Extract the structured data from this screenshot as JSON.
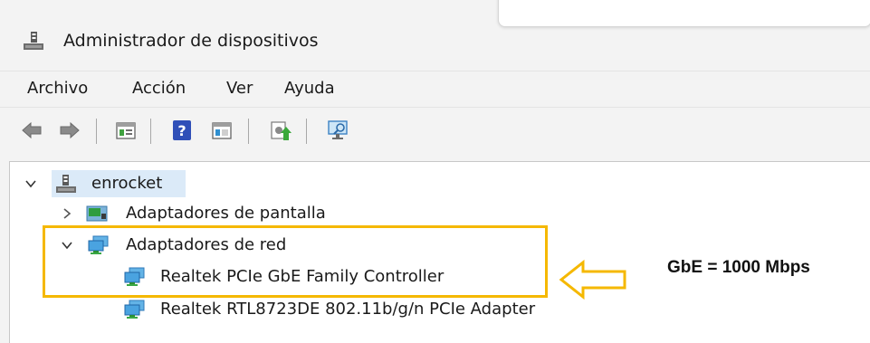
{
  "window": {
    "title": "Administrador de dispositivos"
  },
  "menu": [
    "Archivo",
    "Acción",
    "Ver",
    "Ayuda"
  ],
  "toolbar": {
    "buttons": [
      "back-icon",
      "forward-icon",
      "properties-icon",
      "help-icon",
      "view-icon",
      "update-driver-icon",
      "scan-hardware-icon"
    ]
  },
  "tree": {
    "root": {
      "label": "enrocket",
      "expanded": true
    },
    "categories": [
      {
        "label": "Adaptadores de pantalla",
        "expanded": false
      },
      {
        "label": "Adaptadores de red",
        "expanded": true,
        "children": [
          "Realtek PCIe GbE Family Controller",
          "Realtek RTL8723DE 802.11b/g/n PCIe Adapter"
        ]
      }
    ]
  },
  "annotation": {
    "text": "GbE = 1000 Mbps",
    "color": "#f5b800"
  }
}
